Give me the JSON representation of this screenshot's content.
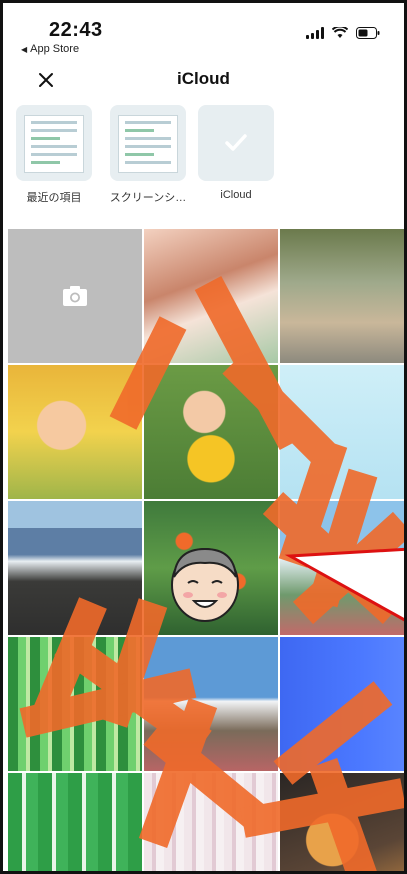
{
  "status_bar": {
    "time": "22:43",
    "back_app_label": "App Store"
  },
  "header": {
    "title": "iCloud",
    "close_icon": "close-icon"
  },
  "albums": [
    {
      "label": "最近の項目",
      "selected": false
    },
    {
      "label": "スクリーンシ…",
      "selected": false
    },
    {
      "label": "iCloud",
      "selected": true
    }
  ],
  "grid": {
    "first_cell_icon": "camera-icon",
    "photo_count_visible": 14
  },
  "watermark": {
    "text": "見本",
    "color": "#f06a2a"
  },
  "colors": {
    "accent": "#f06a2a",
    "selected_check": "#ffffff"
  }
}
